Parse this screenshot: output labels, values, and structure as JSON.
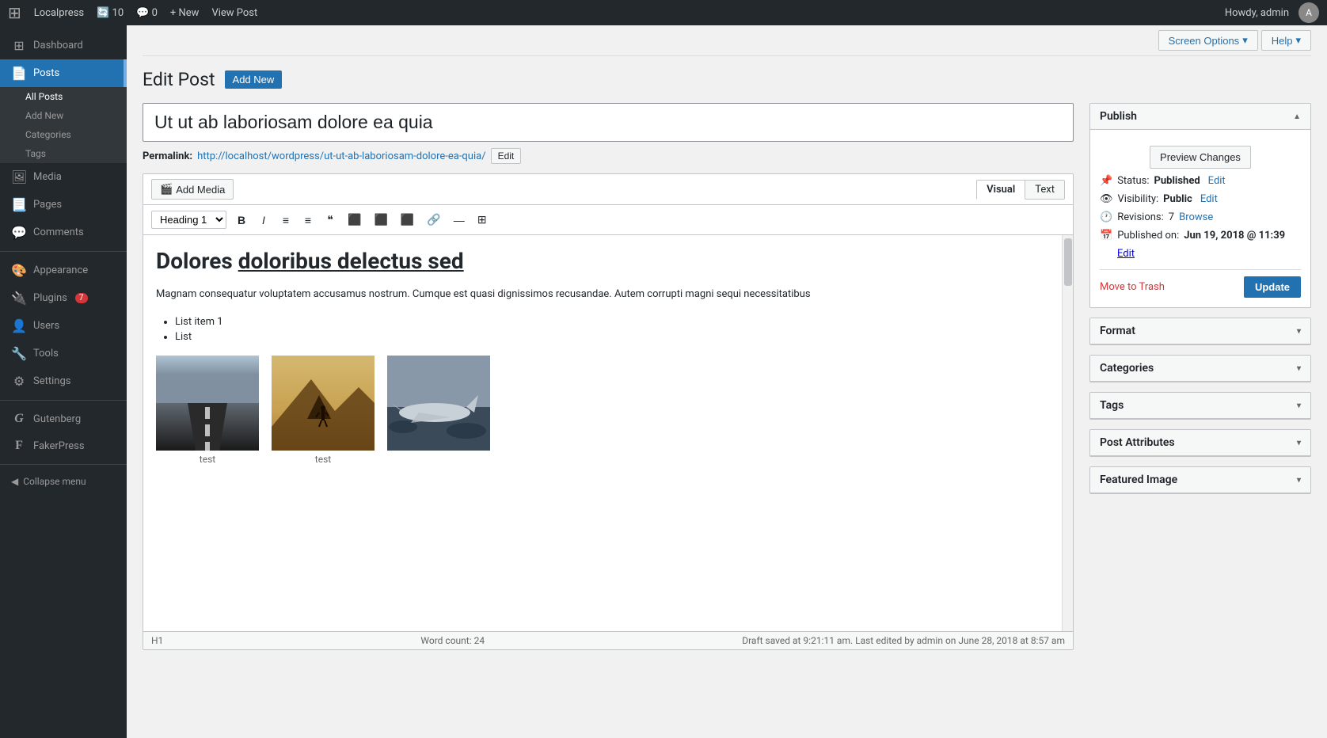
{
  "adminbar": {
    "site_name": "Localpress",
    "update_count": "10",
    "comments_count": "0",
    "new_label": "+ New",
    "view_post_label": "View Post",
    "howdy_label": "Howdy, admin"
  },
  "screen_options": {
    "label": "Screen Options",
    "help_label": "Help"
  },
  "page": {
    "title": "Edit Post",
    "add_new_label": "Add New"
  },
  "post": {
    "title": "Ut ut ab laboriosam dolore ea quia",
    "permalink_label": "Permalink:",
    "permalink_url": "http://localhost/wordpress/ut-ut-ab-laboriosam-dolore-ea-quia/",
    "permalink_edit_label": "Edit"
  },
  "editor": {
    "add_media_label": "Add Media",
    "visual_label": "Visual",
    "text_label": "Text",
    "heading_select": "Heading 1",
    "toolbar_buttons": [
      "B",
      "I",
      "≡",
      "≡",
      "❝",
      "≡",
      "≡",
      "≡",
      "🔗",
      "☰",
      "⊞"
    ],
    "content_heading": "Dolores doloribus delectus sed",
    "content_para": "Magnam consequatur voluptatem accusamus nostrum. Cumque est quasi dignissimos recusandae. Autem corrupti magni sequi necessitatibus",
    "list_items": [
      "List item 1",
      "List"
    ],
    "image_captions": [
      "test",
      "test"
    ],
    "statusbar_left": "H1",
    "statusbar_right": "Draft saved at 9:21:11 am. Last edited by admin on June 28, 2018 at 8:57 am",
    "word_count_label": "Word count:",
    "word_count": "24"
  },
  "publish_panel": {
    "title": "Publish",
    "preview_changes_label": "Preview Changes",
    "status_label": "Status:",
    "status_value": "Published",
    "status_edit_label": "Edit",
    "visibility_label": "Visibility:",
    "visibility_value": "Public",
    "visibility_edit_label": "Edit",
    "revisions_label": "Revisions:",
    "revisions_count": "7",
    "revisions_browse_label": "Browse",
    "published_on_label": "Published on:",
    "published_on_value": "Jun 19, 2018 @ 11:39",
    "published_edit_label": "Edit",
    "move_to_trash_label": "Move to Trash",
    "update_label": "Update"
  },
  "format_panel": {
    "title": "Format"
  },
  "categories_panel": {
    "title": "Categories"
  },
  "tags_panel": {
    "title": "Tags"
  },
  "post_attributes_panel": {
    "title": "Post Attributes"
  },
  "featured_image_panel": {
    "title": "Featured Image"
  },
  "sidebar": {
    "items": [
      {
        "id": "dashboard",
        "label": "Dashboard",
        "icon": "⊞"
      },
      {
        "id": "posts",
        "label": "Posts",
        "icon": "📄"
      },
      {
        "id": "media",
        "label": "Media",
        "icon": "🖼"
      },
      {
        "id": "pages",
        "label": "Pages",
        "icon": "📃"
      },
      {
        "id": "comments",
        "label": "Comments",
        "icon": "💬"
      },
      {
        "id": "appearance",
        "label": "Appearance",
        "icon": "🎨"
      },
      {
        "id": "plugins",
        "label": "Plugins",
        "icon": "🔌",
        "badge": "7"
      },
      {
        "id": "users",
        "label": "Users",
        "icon": "👤"
      },
      {
        "id": "tools",
        "label": "Tools",
        "icon": "🔧"
      },
      {
        "id": "settings",
        "label": "Settings",
        "icon": "⚙"
      },
      {
        "id": "gutenberg",
        "label": "Gutenberg",
        "icon": "G"
      },
      {
        "id": "fakerpress",
        "label": "FakerPress",
        "icon": "F"
      }
    ],
    "posts_submenu": [
      {
        "label": "All Posts",
        "active": true
      },
      {
        "label": "Add New"
      },
      {
        "label": "Categories"
      },
      {
        "label": "Tags"
      }
    ],
    "collapse_label": "Collapse menu"
  }
}
